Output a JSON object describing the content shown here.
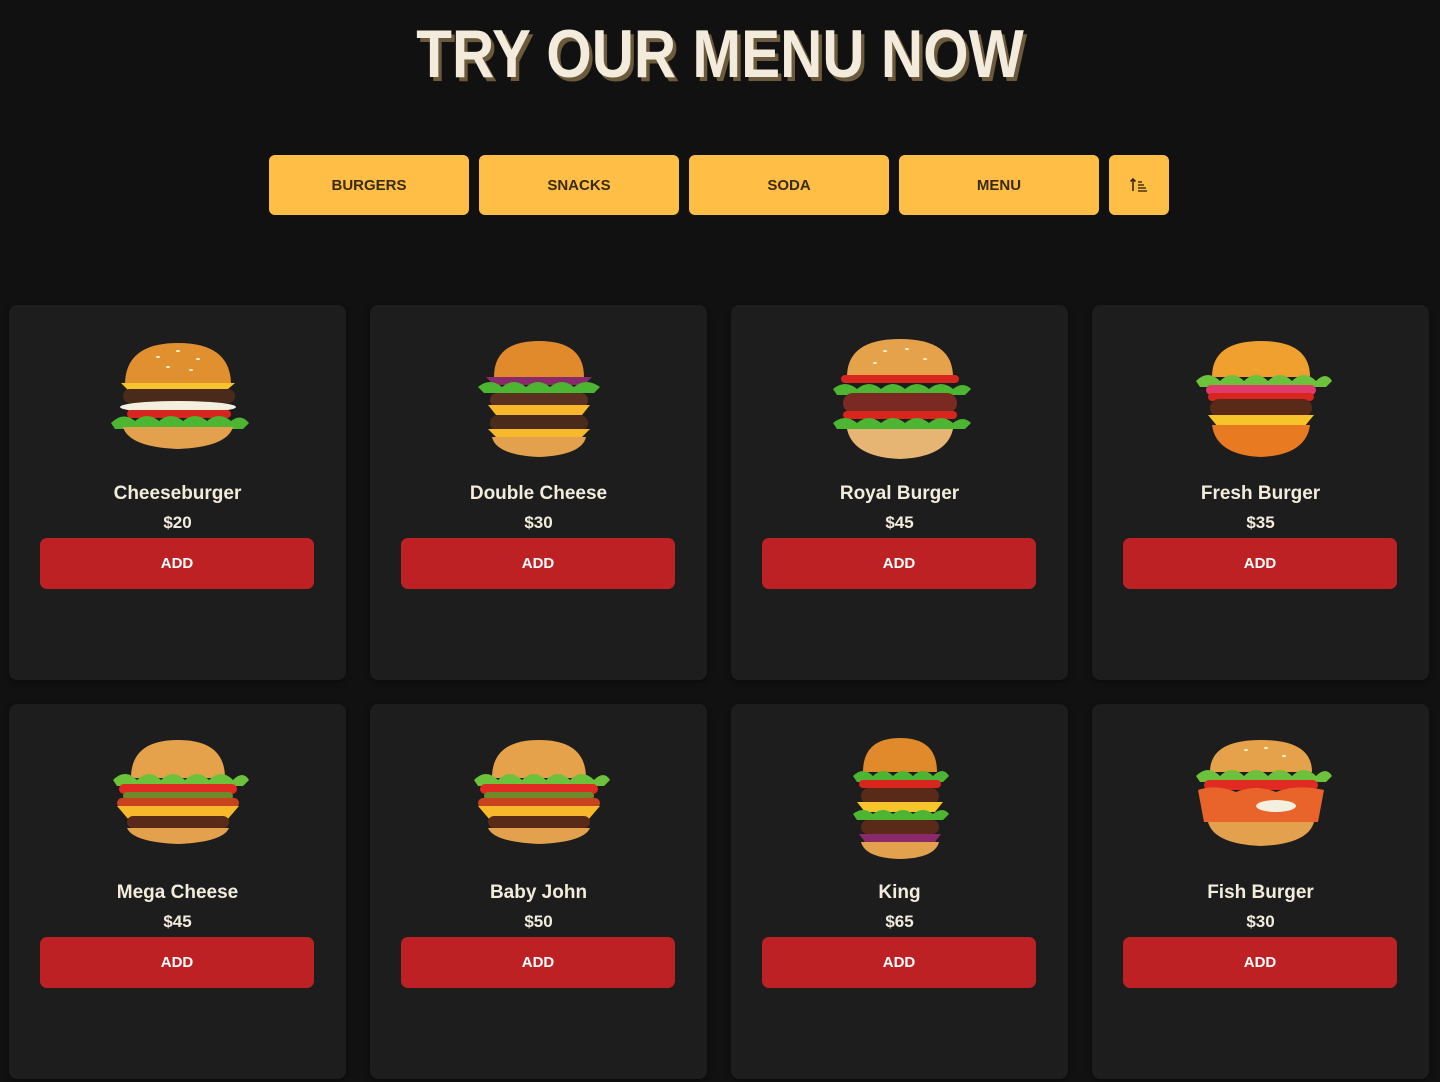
{
  "page": {
    "title": "TRY OUR MENU NOW"
  },
  "filters": [
    {
      "label": "BURGERS"
    },
    {
      "label": "SNACKS"
    },
    {
      "label": "SODA"
    },
    {
      "label": "MENU"
    }
  ],
  "sort_button": {
    "icon": "sort-ascending-icon"
  },
  "colors": {
    "background": "#111111",
    "card": "#1d1d1d",
    "accent_yellow": "#ffbe46",
    "add_red": "#bd2124",
    "title_text": "#f3ecdd"
  },
  "items": [
    {
      "name": "Cheeseburger",
      "price": "$20",
      "add_label": "ADD",
      "image": "cheeseburger-image"
    },
    {
      "name": "Double Cheese",
      "price": "$30",
      "add_label": "ADD",
      "image": "double-cheese-image"
    },
    {
      "name": "Royal Burger",
      "price": "$45",
      "add_label": "ADD",
      "image": "royal-burger-image"
    },
    {
      "name": "Fresh Burger",
      "price": "$35",
      "add_label": "ADD",
      "image": "fresh-burger-image"
    },
    {
      "name": "Mega Cheese",
      "price": "$45",
      "add_label": "ADD",
      "image": "mega-cheese-image"
    },
    {
      "name": "Baby John",
      "price": "$50",
      "add_label": "ADD",
      "image": "baby-john-image"
    },
    {
      "name": "King",
      "price": "$65",
      "add_label": "ADD",
      "image": "king-burger-image"
    },
    {
      "name": "Fish Burger",
      "price": "$30",
      "add_label": "ADD",
      "image": "fish-burger-image"
    }
  ]
}
